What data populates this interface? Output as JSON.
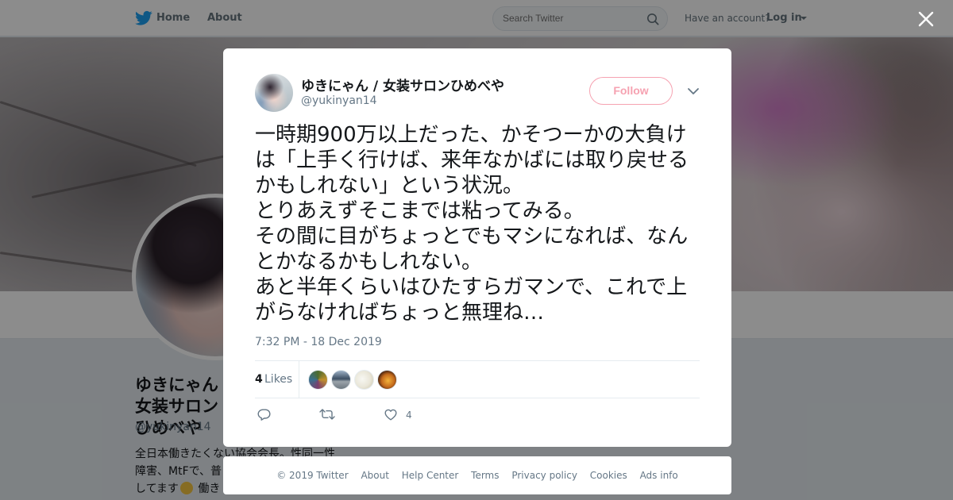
{
  "nav": {
    "home_label": "Home",
    "about_label": "About",
    "search_placeholder": "Search Twitter",
    "account_prompt": "Have an account?",
    "login_label": "Log in"
  },
  "profile": {
    "name": "ゆきにゃん / 女装サロンひめべや",
    "handle": "@yukinyan14",
    "bio_line1": "全日本働きたくない協会会長。性同一性",
    "bio_line2": "障害、MtFで、普",
    "bio_line3a": "してます",
    "bio_line3b": "働き"
  },
  "tweet": {
    "author_name": "ゆきにゃん / 女装サロンひめべや",
    "author_handle": "@yukinyan14",
    "follow_label": "Follow",
    "text": "一時期900万以上だった、かそつーかの大負けは「上手く行けば、来年なかばには取り戻せるかもしれない」という状況。\nとりあえずそこまでは粘ってみる。\nその間に目がちょっとでもマシになれば、なんとかなるかもしれない。\nあと半年くらいはひたすらガマンで、これで上がらなければちょっと無理ね…",
    "timestamp": "7:32 PM - 18 Dec 2019",
    "likes_count": "4",
    "likes_label": "Likes",
    "like_action_count": "4"
  },
  "footer": {
    "links": [
      "© 2019 Twitter",
      "About",
      "Help Center",
      "Terms",
      "Privacy policy",
      "Cookies",
      "Ads info"
    ]
  },
  "colors": {
    "twitter_blue": "#1da1f2",
    "follow_pink": "#f6a2b1",
    "secondary_text": "#657786"
  },
  "icons": {
    "logo": "twitter-bird-icon",
    "search": "search-icon",
    "close": "close-icon",
    "more": "chevron-down-icon",
    "reply": "reply-icon",
    "retweet": "retweet-icon",
    "like": "heart-icon"
  }
}
